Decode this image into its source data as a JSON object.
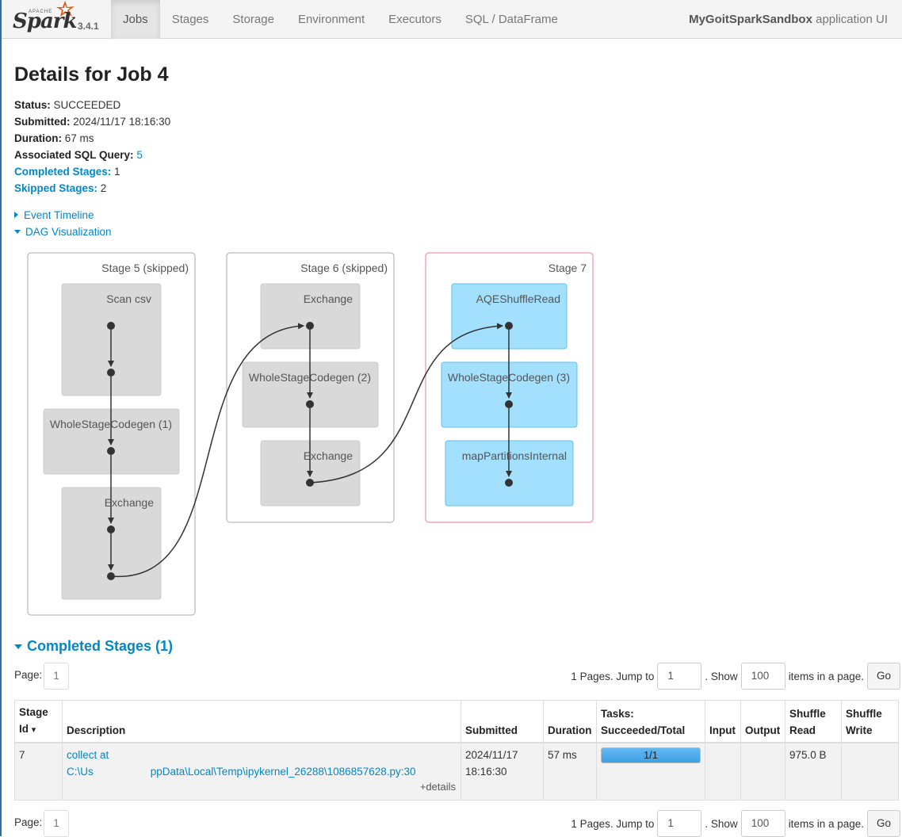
{
  "nav": {
    "apache": "APACHE",
    "brand": "Spark",
    "version": "3.4.1",
    "tabs": [
      "Jobs",
      "Stages",
      "Storage",
      "Environment",
      "Executors",
      "SQL / DataFrame"
    ],
    "active_tab": "Jobs",
    "app_name": "MyGoitSparkSandbox",
    "app_suffix": " application UI"
  },
  "page": {
    "title": "Details for Job 4",
    "status_label": "Status:",
    "status": "SUCCEEDED",
    "submitted_label": "Submitted:",
    "submitted": "2024/11/17 18:16:30",
    "duration_label": "Duration:",
    "duration": "67 ms",
    "sql_label": "Associated SQL Query:",
    "sql_query": "5",
    "completed_label": "Completed Stages:",
    "completed": "1",
    "skipped_label": "Skipped Stages:",
    "skipped": "2",
    "event_timeline": "Event Timeline",
    "dag_visualization": "DAG Visualization"
  },
  "dag": {
    "stages": [
      {
        "label": "Stage 5 (skipped)",
        "state": "skipped",
        "nodes": [
          "Scan csv",
          "WholeStageCodegen (1)",
          "Exchange"
        ]
      },
      {
        "label": "Stage 6 (skipped)",
        "state": "skipped",
        "nodes": [
          "Exchange",
          "WholeStageCodegen (2)",
          "Exchange"
        ]
      },
      {
        "label": "Stage 7",
        "state": "active",
        "nodes": [
          "AQEShuffleRead",
          "WholeStageCodegen (3)",
          "mapPartitionsInternal"
        ]
      }
    ],
    "colors": {
      "skipped_fill": "#d9d9d9",
      "active_fill": "#a2e0fe",
      "active_border": "#f4a6b9",
      "active_node_border": "#5ec1f0"
    }
  },
  "completed_stages": {
    "title": "Completed Stages (1)",
    "pager": {
      "page_label": "Page:",
      "page": "1",
      "pages_text": "1 Pages. Jump to",
      "jump_value": "1",
      "show_text": ". Show",
      "show_value": "100",
      "items_text": "items in a page.",
      "go": "Go"
    },
    "columns": [
      "Stage Id",
      "Description",
      "Submitted",
      "Duration",
      "Tasks: Succeeded/Total",
      "Input",
      "Output",
      "Shuffle Read",
      "Shuffle Write"
    ],
    "sort_indicator": "▾",
    "rows": [
      {
        "stage_id": "7",
        "description_line1": "collect at",
        "description_line2a": "C:\\Us",
        "description_line2b": "ppData\\Local\\Temp\\ipykernel_26288\\1086857628.py:30",
        "details": "+details",
        "submitted": "2024/11/17 18:16:30",
        "duration": "57 ms",
        "tasks": "1/1",
        "tasks_fraction": 1.0,
        "input": "",
        "output": "",
        "shuffle_read": "975.0 B",
        "shuffle_write": ""
      }
    ]
  }
}
